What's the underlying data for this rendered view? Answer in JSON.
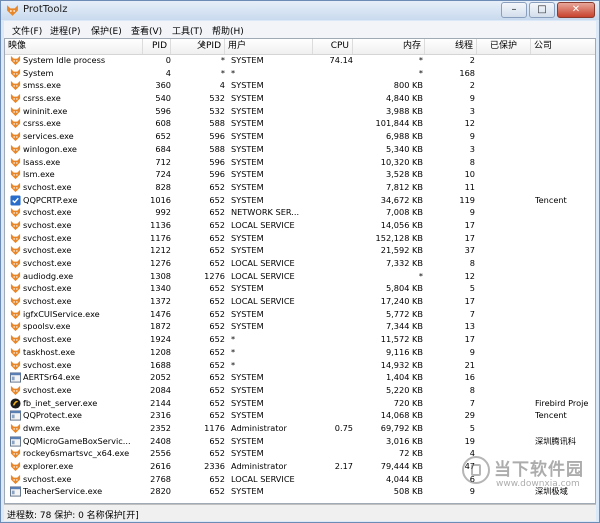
{
  "window": {
    "title": "ProtToolz"
  },
  "menu": [
    "文件(F)",
    "进程(P)",
    "保护(E)",
    "查看(V)",
    "工具(T)",
    "帮助(H)"
  ],
  "columns": {
    "image": "映像",
    "pid": "PID",
    "ppid": "父PID",
    "user": "用户",
    "cpu": "CPU",
    "memory": "内存",
    "threads": "线程",
    "protected": "已保护",
    "company": "公司"
  },
  "rows": [
    {
      "image": "System Idle process",
      "pid": "0",
      "ppid": "*",
      "user": "SYSTEM",
      "cpu": "74.14",
      "mem": "*",
      "threads": "2",
      "company": "",
      "icon": "fox"
    },
    {
      "image": "System",
      "pid": "4",
      "ppid": "*",
      "user": "*",
      "cpu": "",
      "mem": "*",
      "threads": "168",
      "company": "",
      "icon": "fox"
    },
    {
      "image": "smss.exe",
      "pid": "360",
      "ppid": "4",
      "user": "SYSTEM",
      "cpu": "",
      "mem": "800 KB",
      "threads": "2",
      "company": "",
      "icon": "fox"
    },
    {
      "image": "csrss.exe",
      "pid": "540",
      "ppid": "532",
      "user": "SYSTEM",
      "cpu": "",
      "mem": "4,840 KB",
      "threads": "9",
      "company": "",
      "icon": "fox"
    },
    {
      "image": "wininit.exe",
      "pid": "596",
      "ppid": "532",
      "user": "SYSTEM",
      "cpu": "",
      "mem": "3,988 KB",
      "threads": "3",
      "company": "",
      "icon": "fox"
    },
    {
      "image": "csrss.exe",
      "pid": "608",
      "ppid": "588",
      "user": "SYSTEM",
      "cpu": "",
      "mem": "101,844 KB",
      "threads": "12",
      "company": "",
      "icon": "fox"
    },
    {
      "image": "services.exe",
      "pid": "652",
      "ppid": "596",
      "user": "SYSTEM",
      "cpu": "",
      "mem": "6,988 KB",
      "threads": "9",
      "company": "",
      "icon": "fox"
    },
    {
      "image": "winlogon.exe",
      "pid": "684",
      "ppid": "588",
      "user": "SYSTEM",
      "cpu": "",
      "mem": "5,340 KB",
      "threads": "3",
      "company": "",
      "icon": "fox"
    },
    {
      "image": "lsass.exe",
      "pid": "712",
      "ppid": "596",
      "user": "SYSTEM",
      "cpu": "",
      "mem": "10,320 KB",
      "threads": "8",
      "company": "",
      "icon": "fox"
    },
    {
      "image": "lsm.exe",
      "pid": "724",
      "ppid": "596",
      "user": "SYSTEM",
      "cpu": "",
      "mem": "3,528 KB",
      "threads": "10",
      "company": "",
      "icon": "fox"
    },
    {
      "image": "svchost.exe",
      "pid": "828",
      "ppid": "652",
      "user": "SYSTEM",
      "cpu": "",
      "mem": "7,812 KB",
      "threads": "11",
      "company": "",
      "icon": "fox"
    },
    {
      "image": "QQPCRTP.exe",
      "pid": "1016",
      "ppid": "652",
      "user": "SYSTEM",
      "cpu": "",
      "mem": "34,672 KB",
      "threads": "119",
      "company": "Tencent",
      "icon": "shield"
    },
    {
      "image": "svchost.exe",
      "pid": "992",
      "ppid": "652",
      "user": "NETWORK SER...",
      "cpu": "",
      "mem": "7,008 KB",
      "threads": "9",
      "company": "",
      "icon": "fox"
    },
    {
      "image": "svchost.exe",
      "pid": "1136",
      "ppid": "652",
      "user": "LOCAL SERVICE",
      "cpu": "",
      "mem": "14,056 KB",
      "threads": "17",
      "company": "",
      "icon": "fox"
    },
    {
      "image": "svchost.exe",
      "pid": "1176",
      "ppid": "652",
      "user": "SYSTEM",
      "cpu": "",
      "mem": "152,128 KB",
      "threads": "17",
      "company": "",
      "icon": "fox"
    },
    {
      "image": "svchost.exe",
      "pid": "1212",
      "ppid": "652",
      "user": "SYSTEM",
      "cpu": "",
      "mem": "21,592 KB",
      "threads": "37",
      "company": "",
      "icon": "fox"
    },
    {
      "image": "svchost.exe",
      "pid": "1276",
      "ppid": "652",
      "user": "LOCAL SERVICE",
      "cpu": "",
      "mem": "7,332 KB",
      "threads": "8",
      "company": "",
      "icon": "fox"
    },
    {
      "image": "audiodg.exe",
      "pid": "1308",
      "ppid": "1276",
      "user": "LOCAL SERVICE",
      "cpu": "",
      "mem": "*",
      "threads": "12",
      "company": "",
      "icon": "fox"
    },
    {
      "image": "svchost.exe",
      "pid": "1340",
      "ppid": "652",
      "user": "SYSTEM",
      "cpu": "",
      "mem": "5,804 KB",
      "threads": "5",
      "company": "",
      "icon": "fox"
    },
    {
      "image": "svchost.exe",
      "pid": "1372",
      "ppid": "652",
      "user": "LOCAL SERVICE",
      "cpu": "",
      "mem": "17,240 KB",
      "threads": "17",
      "company": "",
      "icon": "fox"
    },
    {
      "image": "igfxCUIService.exe",
      "pid": "1476",
      "ppid": "652",
      "user": "SYSTEM",
      "cpu": "",
      "mem": "5,772 KB",
      "threads": "7",
      "company": "",
      "icon": "fox"
    },
    {
      "image": "spoolsv.exe",
      "pid": "1872",
      "ppid": "652",
      "user": "SYSTEM",
      "cpu": "",
      "mem": "7,344 KB",
      "threads": "13",
      "company": "",
      "icon": "fox"
    },
    {
      "image": "svchost.exe",
      "pid": "1924",
      "ppid": "652",
      "user": "*",
      "cpu": "",
      "mem": "11,572 KB",
      "threads": "17",
      "company": "",
      "icon": "fox"
    },
    {
      "image": "taskhost.exe",
      "pid": "1208",
      "ppid": "652",
      "user": "*",
      "cpu": "",
      "mem": "9,116 KB",
      "threads": "9",
      "company": "",
      "icon": "fox"
    },
    {
      "image": "svchost.exe",
      "pid": "1688",
      "ppid": "652",
      "user": "*",
      "cpu": "",
      "mem": "14,932 KB",
      "threads": "21",
      "company": "",
      "icon": "fox"
    },
    {
      "image": "AERTSr64.exe",
      "pid": "2052",
      "ppid": "652",
      "user": "SYSTEM",
      "cpu": "",
      "mem": "1,404 KB",
      "threads": "16",
      "company": "",
      "icon": "app"
    },
    {
      "image": "svchost.exe",
      "pid": "2084",
      "ppid": "652",
      "user": "SYSTEM",
      "cpu": "",
      "mem": "5,220 KB",
      "threads": "8",
      "company": "",
      "icon": "fox"
    },
    {
      "image": "fb_inet_server.exe",
      "pid": "2144",
      "ppid": "652",
      "user": "SYSTEM",
      "cpu": "",
      "mem": "720 KB",
      "threads": "7",
      "company": "Firebird Proje",
      "icon": "firebird"
    },
    {
      "image": "QQProtect.exe",
      "pid": "2316",
      "ppid": "652",
      "user": "SYSTEM",
      "cpu": "",
      "mem": "14,068 KB",
      "threads": "29",
      "company": "Tencent",
      "icon": "app"
    },
    {
      "image": "dwm.exe",
      "pid": "2352",
      "ppid": "1176",
      "user": "Administrator",
      "cpu": "0.75",
      "mem": "69,792 KB",
      "threads": "5",
      "company": "",
      "icon": "fox"
    },
    {
      "image": "QQMicroGameBoxServic...",
      "pid": "2408",
      "ppid": "652",
      "user": "SYSTEM",
      "cpu": "",
      "mem": "3,016 KB",
      "threads": "19",
      "company": "深圳腾讯科",
      "icon": "app"
    },
    {
      "image": "rockey6smartsvc_x64.exe",
      "pid": "2556",
      "ppid": "652",
      "user": "SYSTEM",
      "cpu": "",
      "mem": "72 KB",
      "threads": "4",
      "company": "",
      "icon": "fox"
    },
    {
      "image": "explorer.exe",
      "pid": "2616",
      "ppid": "2336",
      "user": "Administrator",
      "cpu": "2.17",
      "mem": "79,444 KB",
      "threads": "47",
      "company": "",
      "icon": "fox"
    },
    {
      "image": "svchost.exe",
      "pid": "2768",
      "ppid": "652",
      "user": "LOCAL SERVICE",
      "cpu": "",
      "mem": "4,044 KB",
      "threads": "6",
      "company": "",
      "icon": "fox"
    },
    {
      "image": "TeacherService.exe",
      "pid": "2820",
      "ppid": "652",
      "user": "SYSTEM",
      "cpu": "",
      "mem": "508 KB",
      "threads": "9",
      "company": "深圳极域",
      "icon": "app"
    }
  ],
  "status": "进程数: 78   保护: 0   名称保护[开]",
  "watermark": {
    "brand": "当下软件园",
    "url": "www.downxia.com"
  },
  "colors": {
    "titlebar": "#c9daee",
    "fox_icon": "#e8872a",
    "shield_icon": "#2a6cc9"
  }
}
